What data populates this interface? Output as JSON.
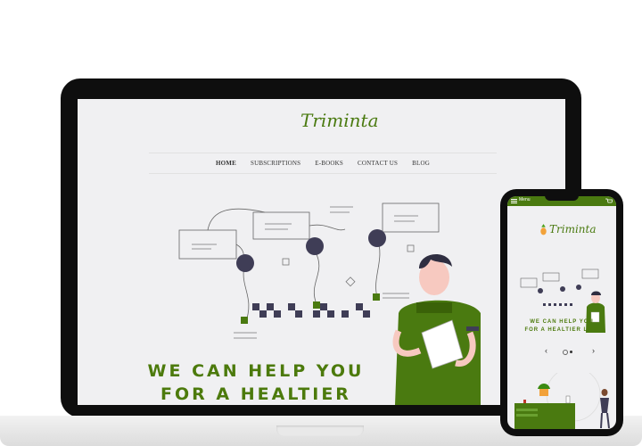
{
  "site": {
    "brand": "Triminta",
    "nav": [
      {
        "label": "HOME",
        "active": true
      },
      {
        "label": "SUBSCRIPTIONS",
        "active": false
      },
      {
        "label": "E-BOOKS",
        "active": false
      },
      {
        "label": "CONTACT US",
        "active": false
      },
      {
        "label": "BLOG",
        "active": false
      }
    ],
    "hero_line1": "WE CAN HELP YOU",
    "hero_line2": "FOR  A HEALTIER LIFE"
  },
  "phone": {
    "menu_label": "Menu",
    "brand": "Triminta",
    "hero_line1": "WE CAN HELP YOU",
    "hero_line2": "FOR  A HEALTIER LIFE",
    "prev_arrow": "‹",
    "next_arrow": "›"
  },
  "colors": {
    "brand_green": "#4a7a10",
    "dark": "#0e0e0e",
    "screen_bg": "#f0f0f2"
  }
}
